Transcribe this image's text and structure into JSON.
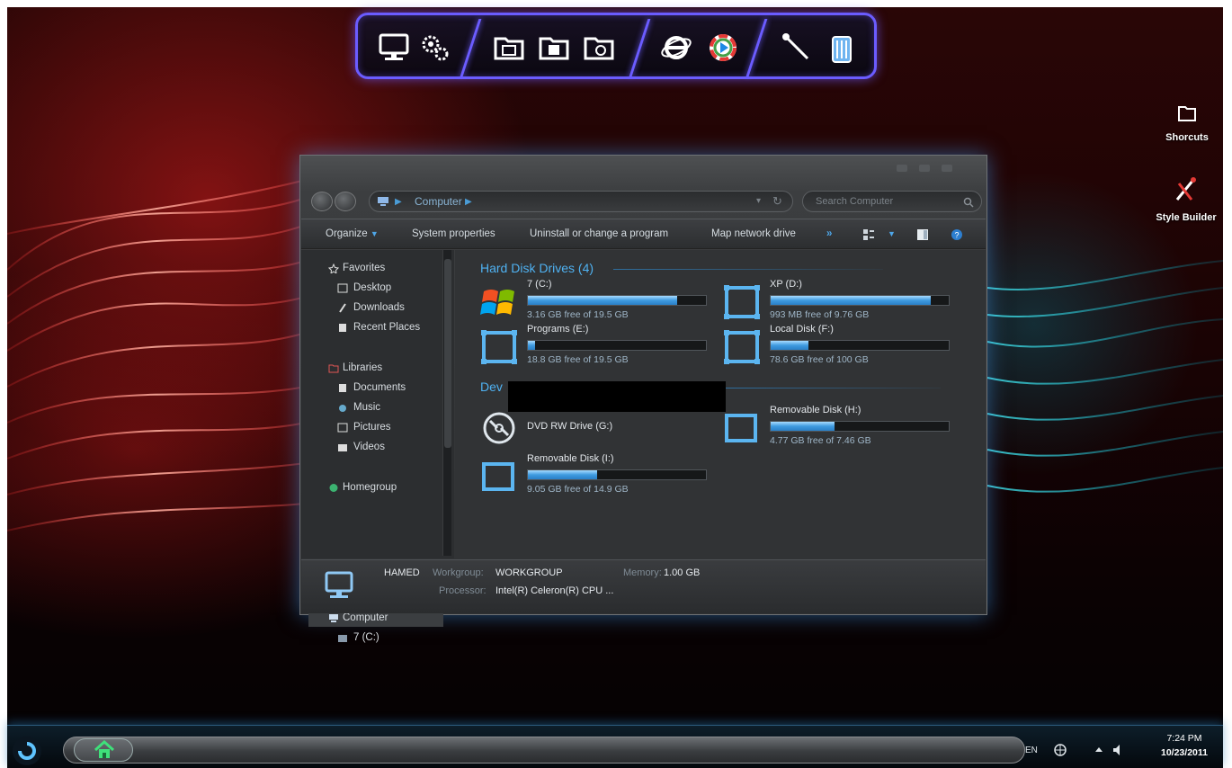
{
  "dock": {
    "icons": [
      "computer-icon",
      "gears-icon",
      "folder-icon",
      "folder-icon",
      "folder-icon",
      "internet-explorer-icon",
      "media-player-icon",
      "tools-icon",
      "recycle-bin-icon"
    ]
  },
  "desktop": {
    "icons": [
      {
        "label": "Shorcuts",
        "icon": "folder-icon"
      },
      {
        "label": "Style Builder",
        "icon": "style-builder-icon"
      }
    ]
  },
  "explorer": {
    "breadcrumb": "Computer",
    "search_placeholder": "Search Computer",
    "toolbar": {
      "organize": "Organize",
      "system_properties": "System properties",
      "uninstall": "Uninstall or change a program",
      "map_drive": "Map network drive",
      "more": "»"
    },
    "sidebar": {
      "favorites": "Favorites",
      "desktop": "Desktop",
      "downloads": "Downloads",
      "recent_places": "Recent Places",
      "libraries": "Libraries",
      "documents": "Documents",
      "music": "Music",
      "pictures": "Pictures",
      "videos": "Videos",
      "homegroup": "Homegroup",
      "computer": "Computer",
      "drive_c": "7 (C:)"
    },
    "groups": {
      "hard_disk": "Hard Disk Drives (4)",
      "devices": "Dev"
    },
    "drives": [
      {
        "name": "7 (C:)",
        "free": "3.16 GB free of 19.5 GB",
        "used_fraction": 0.84
      },
      {
        "name": "XP (D:)",
        "free": "993 MB free of 9.76 GB",
        "used_fraction": 0.9
      },
      {
        "name": "Programs (E:)",
        "free": "18.8 GB free of 19.5 GB",
        "used_fraction": 0.04
      },
      {
        "name": "Local Disk (F:)",
        "free": "78.6 GB free of 100 GB",
        "used_fraction": 0.21
      },
      {
        "name": "DVD RW Drive (G:)"
      },
      {
        "name": "Removable Disk (H:)",
        "free": "4.77 GB free of 7.46 GB",
        "used_fraction": 0.36
      },
      {
        "name": "Removable Disk (I:)",
        "free": "9.05 GB free of 14.9 GB",
        "used_fraction": 0.39
      }
    ],
    "details": {
      "name": "HAMED",
      "workgroup_label": "Workgroup:",
      "workgroup": "WORKGROUP",
      "memory_label": "Memory:",
      "memory": "1.00 GB",
      "processor_label": "Processor:",
      "processor": "Intel(R) Celeron(R) CPU ..."
    }
  },
  "taskbar": {
    "lang": "EN",
    "time": "7:24 PM",
    "date": "10/23/2011"
  },
  "colors": {
    "accent": "#4fb2f2",
    "dock_border": "#6b5cff"
  }
}
